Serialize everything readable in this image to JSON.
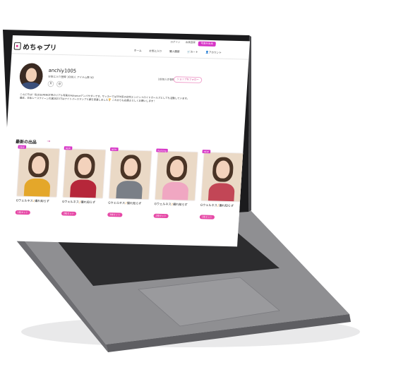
{
  "colors": {
    "accent": "#d634c6",
    "laptop_body": "#8d8d8f",
    "keyboard": "#2c2c2e"
  },
  "app": {
    "logo": "めちゃプリ"
  },
  "top_links": [
    "ログイン",
    "会員登録",
    "お知らせ"
  ],
  "sell_button": "写真を出品",
  "nav": [
    "ホーム",
    "お気に入り",
    "購入履歴",
    "カート",
    "アカウント"
  ],
  "nav_icons": [
    "home-icon",
    "heart-icon",
    "receipt-icon",
    "cart-icon",
    "user-icon"
  ],
  "profile": {
    "username": "anchiy1005",
    "stats": "お気に入り登録 1000人 アイテム数 50",
    "followers": "1000人が登録",
    "follow_button": "ショップをフォロー",
    "bio_line1": "こんにちは！私はSUPERGT界のリアル写真のAdvanceアンバサダーです。サッカーではTFM系の初代エンジントロイドガールズとしても活動しています。",
    "bio_line2": "最近、日本レースクイーン大賞2023ではナイトパースマンプリ賞を受賞しました🏆 これからも応援よろしくお願いします！"
  },
  "section": {
    "title": "最新の出品",
    "arrow": "→"
  },
  "cards": [
    {
      "badge": "NEW",
      "title_pre": "Gウェルネス",
      "title_post": "撮れ知らず",
      "tag": "1枚セット",
      "body_color": "#e4a72a"
    },
    {
      "badge": "NEW",
      "title_pre": "Gウェルネス",
      "title_post": "撮れ知らず",
      "tag": "2枚セット",
      "body_color": "#b6273a"
    },
    {
      "badge": "NEW",
      "title_pre": "Gウェルネス",
      "title_post": "撮れ知らず",
      "tag": "3枚セット",
      "body_color": "#7a7f87"
    },
    {
      "badge": "Ranking",
      "title_pre": "Gウェルネス",
      "title_post": "撮れ知らず",
      "tag": "2枚セット",
      "body_color": "#f0a7c2"
    },
    {
      "badge": "NEW",
      "title_pre": "Gウェルネス",
      "title_post": "撮れ知らず",
      "tag": "1枚セット",
      "body_color": "#c24656"
    }
  ],
  "title_mark": "♪"
}
